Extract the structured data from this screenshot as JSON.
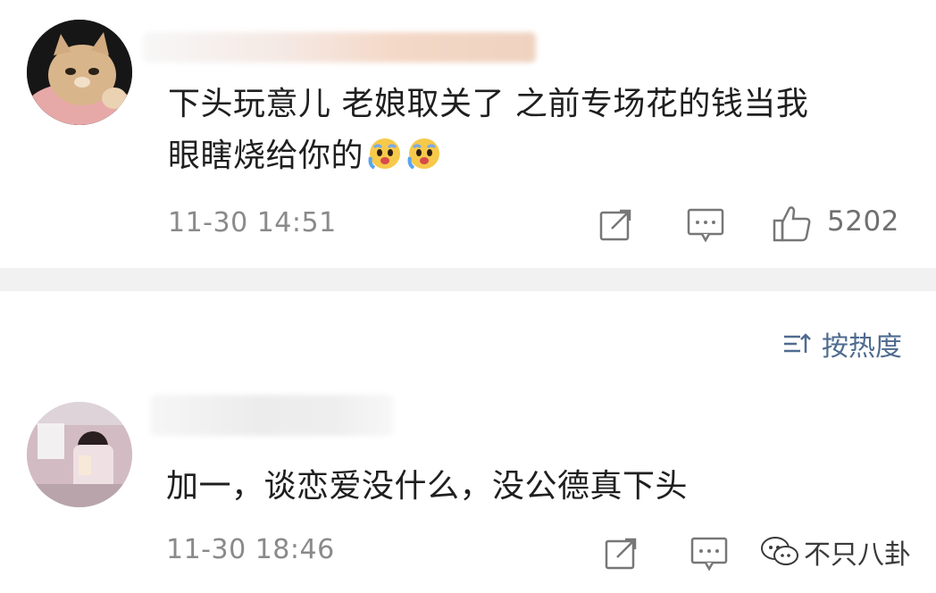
{
  "comments": [
    {
      "avatar": "cat-avatar",
      "text_line1": "下头玩意儿 老娘取关了 之前专场花的钱当我",
      "text_line2": "眼瞎烧给你的",
      "emojis": [
        "crying-face-emoji",
        "crying-face-emoji"
      ],
      "time": "11-30 14:51",
      "like_count": "5202"
    },
    {
      "avatar": "girl-mirror-selfie-avatar",
      "text_line1": "加一，谈恋爱没什么，没公德真下头",
      "time": "11-30 18:46"
    }
  ],
  "sort": {
    "label": "按热度",
    "icon": "sort-icon"
  },
  "watermark": {
    "text": "不只八卦",
    "icon": "chat-bubble-icon"
  },
  "colors": {
    "text": "#1f1f1f",
    "time": "#8a8a8a",
    "sort_accent": "#4f6b8f",
    "divider": "#f1f1f1",
    "icon_gray": "#7a7a7a"
  }
}
